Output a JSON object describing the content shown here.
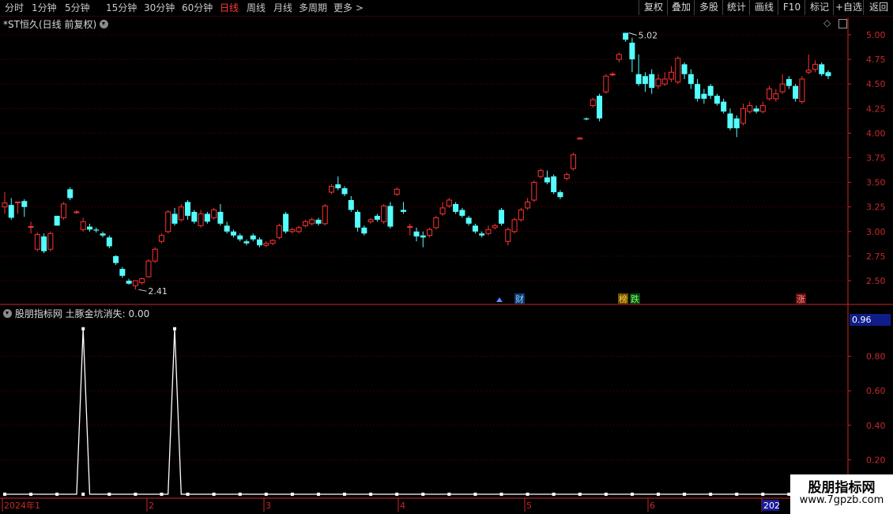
{
  "toolbar": {
    "periods": [
      "分时",
      "1分钟",
      "5分钟",
      "15分钟",
      "30分钟",
      "60分钟",
      "日线",
      "周线",
      "月线",
      "多周期",
      "更多 >"
    ],
    "active_period": "日线",
    "right_buttons": [
      "复权",
      "叠加",
      "多股",
      "统计",
      "画线",
      "F10",
      "标记",
      "+自选",
      "返回"
    ]
  },
  "main_panel": {
    "title": "*ST恒久(日线 前复权)",
    "high_label": "5.02",
    "low_label": "2.41",
    "event_tags": [
      "财",
      "榜",
      "跌",
      "涨"
    ],
    "colors": {
      "up": "#ff3232",
      "down": "#54ffff",
      "grid": "#6a0000",
      "axis": "#c82828"
    }
  },
  "indicator_panel": {
    "title": "股朋指标网",
    "formula_label": "土豚金坑消失: 0.00",
    "current_value": "0.96"
  },
  "xaxis": {
    "labels": [
      "2024年1",
      "2",
      "3",
      "4",
      "5",
      "6",
      "202"
    ]
  },
  "watermark": {
    "line1": "股朋指标网",
    "line2": "www.7gpzb.com"
  },
  "chart_data": [
    {
      "type": "candlestick",
      "title": "*ST恒久(日线 前复权)",
      "y_ticks": [
        "5.00",
        "4.75",
        "4.50",
        "4.25",
        "4.00",
        "3.75",
        "3.50",
        "3.25",
        "3.00",
        "2.75",
        "2.50"
      ],
      "ylim": [
        2.35,
        5.1
      ],
      "candles": [
        [
          3.25,
          3.29,
          3.4,
          3.18
        ],
        [
          3.27,
          3.14,
          3.34,
          3.12
        ],
        [
          3.3,
          3.3,
          3.3,
          3.18
        ],
        [
          3.31,
          3.25,
          3.33,
          3.15
        ],
        [
          3.05,
          3.05,
          3.1,
          2.98
        ],
        [
          2.82,
          2.97,
          2.99,
          2.8
        ],
        [
          2.95,
          2.8,
          2.98,
          2.78
        ],
        [
          2.82,
          2.98,
          3.0,
          2.8
        ],
        [
          3.16,
          3.06,
          3.16,
          3.06
        ],
        [
          3.14,
          3.28,
          3.3,
          3.12
        ],
        [
          3.43,
          3.34,
          3.45,
          3.32
        ],
        [
          3.2,
          3.2,
          3.22,
          3.18
        ],
        [
          3.02,
          3.1,
          3.14,
          3.0
        ],
        [
          3.05,
          3.02,
          3.08,
          3.0
        ],
        [
          3.02,
          3.01,
          3.04,
          2.99
        ],
        [
          2.98,
          2.96,
          3.0,
          2.94
        ],
        [
          2.94,
          2.85,
          2.96,
          2.83
        ],
        [
          2.75,
          2.68,
          2.76,
          2.66
        ],
        [
          2.62,
          2.55,
          2.64,
          2.53
        ],
        [
          2.5,
          2.47,
          2.52,
          2.46
        ],
        [
          2.45,
          2.5,
          2.5,
          2.41
        ],
        [
          2.48,
          2.52,
          2.53,
          2.46
        ],
        [
          2.54,
          2.7,
          2.72,
          2.53
        ],
        [
          2.7,
          2.82,
          2.84,
          2.68
        ],
        [
          2.9,
          2.96,
          2.98,
          2.88
        ],
        [
          3.0,
          3.2,
          3.22,
          2.98
        ],
        [
          3.18,
          3.08,
          3.24,
          3.06
        ],
        [
          3.12,
          3.25,
          3.28,
          3.1
        ],
        [
          3.3,
          3.16,
          3.32,
          3.12
        ],
        [
          3.2,
          3.1,
          3.22,
          3.08
        ],
        [
          3.06,
          3.18,
          3.22,
          3.04
        ],
        [
          3.18,
          3.1,
          3.2,
          3.08
        ],
        [
          3.14,
          3.22,
          3.24,
          3.12
        ],
        [
          3.2,
          3.08,
          3.28,
          3.06
        ],
        [
          3.06,
          3.0,
          3.1,
          2.98
        ],
        [
          3.0,
          2.96,
          3.02,
          2.94
        ],
        [
          2.96,
          2.92,
          2.98,
          2.9
        ],
        [
          2.9,
          2.88,
          2.92,
          2.86
        ],
        [
          2.96,
          2.92,
          2.98,
          2.9
        ],
        [
          2.92,
          2.86,
          2.94,
          2.84
        ],
        [
          2.86,
          2.88,
          2.9,
          2.84
        ],
        [
          2.88,
          2.91,
          2.92,
          2.86
        ],
        [
          2.94,
          3.06,
          3.08,
          2.92
        ],
        [
          3.18,
          3.0,
          3.2,
          2.98
        ],
        [
          3.0,
          3.02,
          3.04,
          2.98
        ],
        [
          3.0,
          3.04,
          3.06,
          2.98
        ],
        [
          3.06,
          3.1,
          3.12,
          3.04
        ],
        [
          3.08,
          3.12,
          3.14,
          3.06
        ],
        [
          3.12,
          3.08,
          3.14,
          3.06
        ],
        [
          3.08,
          3.26,
          3.28,
          3.06
        ],
        [
          3.4,
          3.46,
          3.48,
          3.38
        ],
        [
          3.48,
          3.44,
          3.56,
          3.42
        ],
        [
          3.44,
          3.38,
          3.46,
          3.36
        ],
        [
          3.32,
          3.22,
          3.36,
          3.2
        ],
        [
          3.2,
          3.04,
          3.22,
          3.0
        ],
        [
          3.04,
          2.98,
          3.06,
          2.96
        ],
        [
          3.1,
          3.12,
          3.14,
          3.08
        ],
        [
          3.16,
          3.12,
          3.18,
          3.1
        ],
        [
          3.1,
          3.26,
          3.28,
          3.08
        ],
        [
          3.26,
          3.05,
          3.3,
          3.03
        ],
        [
          3.38,
          3.43,
          3.45,
          3.36
        ],
        [
          3.22,
          3.2,
          3.3,
          3.18
        ],
        [
          3.05,
          3.05,
          3.08,
          2.96
        ],
        [
          3.0,
          2.95,
          3.04,
          2.9
        ],
        [
          2.96,
          2.94,
          3.0,
          2.84
        ],
        [
          2.96,
          3.02,
          3.04,
          2.94
        ],
        [
          3.04,
          3.14,
          3.16,
          3.02
        ],
        [
          3.18,
          3.24,
          3.3,
          3.16
        ],
        [
          3.26,
          3.32,
          3.34,
          3.24
        ],
        [
          3.28,
          3.2,
          3.3,
          3.18
        ],
        [
          3.22,
          3.16,
          3.24,
          3.14
        ],
        [
          3.14,
          3.08,
          3.16,
          3.06
        ],
        [
          3.06,
          3.0,
          3.08,
          2.98
        ],
        [
          2.98,
          2.96,
          3.0,
          2.94
        ],
        [
          2.98,
          3.02,
          3.06,
          2.96
        ],
        [
          3.04,
          3.06,
          3.08,
          3.02
        ],
        [
          3.22,
          3.08,
          3.24,
          3.06
        ],
        [
          2.9,
          3.02,
          3.04,
          2.86
        ],
        [
          3.0,
          3.12,
          3.14,
          2.98
        ],
        [
          3.12,
          3.22,
          3.24,
          3.1
        ],
        [
          3.24,
          3.3,
          3.34,
          3.22
        ],
        [
          3.32,
          3.5,
          3.52,
          3.3
        ],
        [
          3.56,
          3.62,
          3.64,
          3.54
        ],
        [
          3.55,
          3.5,
          3.62,
          3.48
        ],
        [
          3.56,
          3.4,
          3.58,
          3.38
        ],
        [
          3.4,
          3.35,
          3.42,
          3.33
        ],
        [
          3.54,
          3.58,
          3.6,
          3.52
        ],
        [
          3.64,
          3.78,
          3.8,
          3.62
        ],
        [
          3.94,
          3.95,
          3.96,
          3.94
        ],
        [
          4.15,
          4.14,
          4.16,
          4.13
        ],
        [
          4.28,
          4.34,
          4.36,
          4.26
        ],
        [
          4.38,
          4.15,
          4.4,
          4.12
        ],
        [
          4.42,
          4.58,
          4.6,
          4.4
        ],
        [
          4.6,
          4.6,
          4.62,
          4.58
        ],
        [
          4.75,
          4.8,
          4.82,
          4.72
        ],
        [
          5.02,
          4.95,
          5.02,
          4.93
        ],
        [
          4.92,
          4.75,
          4.97,
          4.62
        ],
        [
          4.6,
          4.5,
          4.8,
          4.48
        ],
        [
          4.58,
          4.5,
          4.62,
          4.42
        ],
        [
          4.6,
          4.46,
          4.65,
          4.4
        ],
        [
          4.48,
          4.55,
          4.6,
          4.45
        ],
        [
          4.5,
          4.55,
          4.62,
          4.48
        ],
        [
          4.55,
          4.62,
          4.68,
          4.52
        ],
        [
          4.52,
          4.76,
          4.78,
          4.5
        ],
        [
          4.7,
          4.6,
          4.72,
          4.55
        ],
        [
          4.6,
          4.5,
          4.65,
          4.45
        ],
        [
          4.5,
          4.35,
          4.55,
          4.32
        ],
        [
          4.4,
          4.35,
          4.45,
          4.3
        ],
        [
          4.48,
          4.38,
          4.5,
          4.35
        ],
        [
          4.38,
          4.3,
          4.4,
          4.28
        ],
        [
          4.32,
          4.22,
          4.35,
          4.2
        ],
        [
          4.2,
          4.05,
          4.25,
          4.03
        ],
        [
          4.15,
          4.05,
          4.18,
          3.96
        ],
        [
          4.1,
          4.25,
          4.3,
          4.08
        ],
        [
          4.22,
          4.28,
          4.32,
          4.2
        ],
        [
          4.25,
          4.22,
          4.28,
          4.2
        ],
        [
          4.22,
          4.28,
          4.32,
          4.2
        ],
        [
          4.35,
          4.45,
          4.48,
          4.33
        ],
        [
          4.35,
          4.4,
          4.45,
          4.32
        ],
        [
          4.42,
          4.5,
          4.6,
          4.4
        ],
        [
          4.55,
          4.48,
          4.58,
          4.45
        ],
        [
          4.48,
          4.35,
          4.5,
          4.32
        ],
        [
          4.32,
          4.55,
          4.58,
          4.3
        ],
        [
          4.62,
          4.64,
          4.8,
          4.6
        ],
        [
          4.65,
          4.7,
          4.74,
          4.62
        ],
        [
          4.7,
          4.6,
          4.72,
          4.58
        ],
        [
          4.62,
          4.58,
          4.64,
          4.55
        ]
      ],
      "annotations": [
        {
          "text": "5.02",
          "value": 5.02
        },
        {
          "text": "2.41",
          "value": 2.41
        }
      ]
    },
    {
      "type": "line",
      "title": "股朋指标网",
      "y_ticks": [
        "0.80",
        "0.60",
        "0.40",
        "0.20"
      ],
      "ylim": [
        0,
        1.0
      ],
      "spikes": [
        {
          "index": 12,
          "value": 0.96
        },
        {
          "index": 26,
          "value": 0.96
        }
      ],
      "baseline": 0
    }
  ]
}
